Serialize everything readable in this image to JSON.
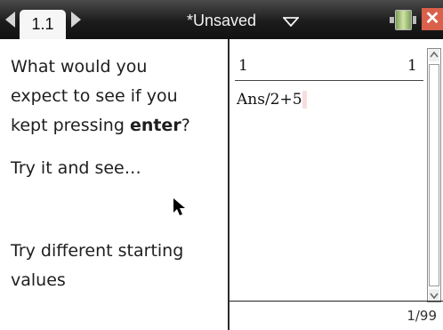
{
  "header": {
    "tab_label": "1.1",
    "document_title": "*Unsaved"
  },
  "left_panel": {
    "paragraph1": {
      "line1": "What would you",
      "line2": "expect to see if you",
      "line3_prefix": "kept pressing ",
      "line3_bold": "enter",
      "line3_suffix": "?"
    },
    "paragraph2": "Try it and see…",
    "paragraph3": {
      "line1": "Try different starting",
      "line2": "values"
    }
  },
  "calculator": {
    "history_input": "1",
    "history_result": "1",
    "entry_text": "Ans/2+5",
    "status": "1/99"
  },
  "icons": [
    "nav-left-icon",
    "nav-right-icon",
    "dropdown-icon",
    "battery-icon",
    "close-icon",
    "cursor-icon",
    "scroll-up-icon",
    "scroll-down-icon"
  ],
  "colors": {
    "titlebar": "#1c1c1c",
    "close_button": "#d9604a",
    "battery": "#a4c46c",
    "entry_highlight": "#f7dede"
  }
}
